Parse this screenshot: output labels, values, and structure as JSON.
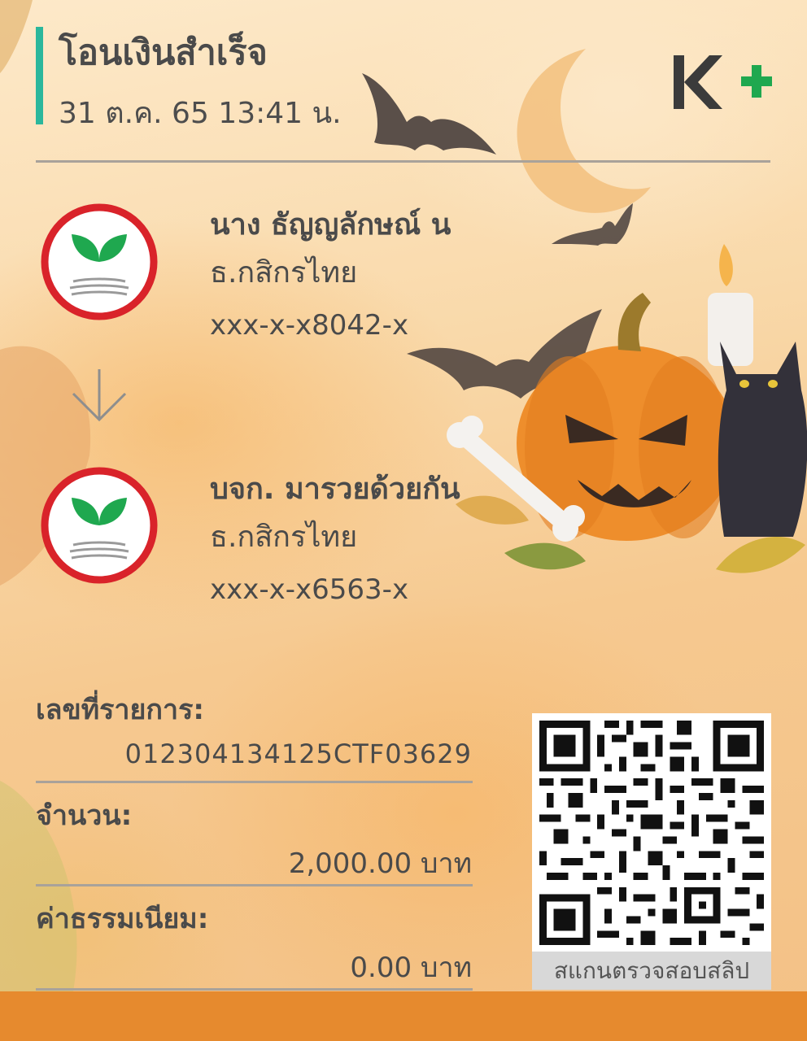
{
  "receipt": {
    "title": "โอนเงินสำเร็จ",
    "datetime": "31 ต.ค. 65  13:41 น.",
    "brand_logo": "K+",
    "accent_color": "#2bb79c",
    "brand_colors": {
      "k_dark": "#3b3b3b",
      "plus_green": "#1fa84f"
    }
  },
  "sender": {
    "name": "นาง ธัญญลักษณ์ น",
    "bank": "ธ.กสิกรไทย",
    "account": "xxx-x-x8042-x",
    "icon": "kbank-logo-icon"
  },
  "transfer_arrow_icon": "arrow-down-icon",
  "recipient": {
    "name": "บจก. มารวยด้วยกัน",
    "bank": "ธ.กสิกรไทย",
    "account": "xxx-x-x6563-x",
    "icon": "kbank-logo-icon"
  },
  "details": {
    "ref_label": "เลขที่รายการ:",
    "ref_value": "012304134125CTF03629",
    "amount_label": "จำนวน:",
    "amount_value": "2,000.00 บาท",
    "fee_label": "ค่าธรรมเนียม:",
    "fee_value": "0.00 บาท"
  },
  "qr": {
    "caption": "สแกนตรวจสอบสลิป",
    "icon": "qr-code-icon"
  },
  "footer_bar_color": "#e68a2e"
}
